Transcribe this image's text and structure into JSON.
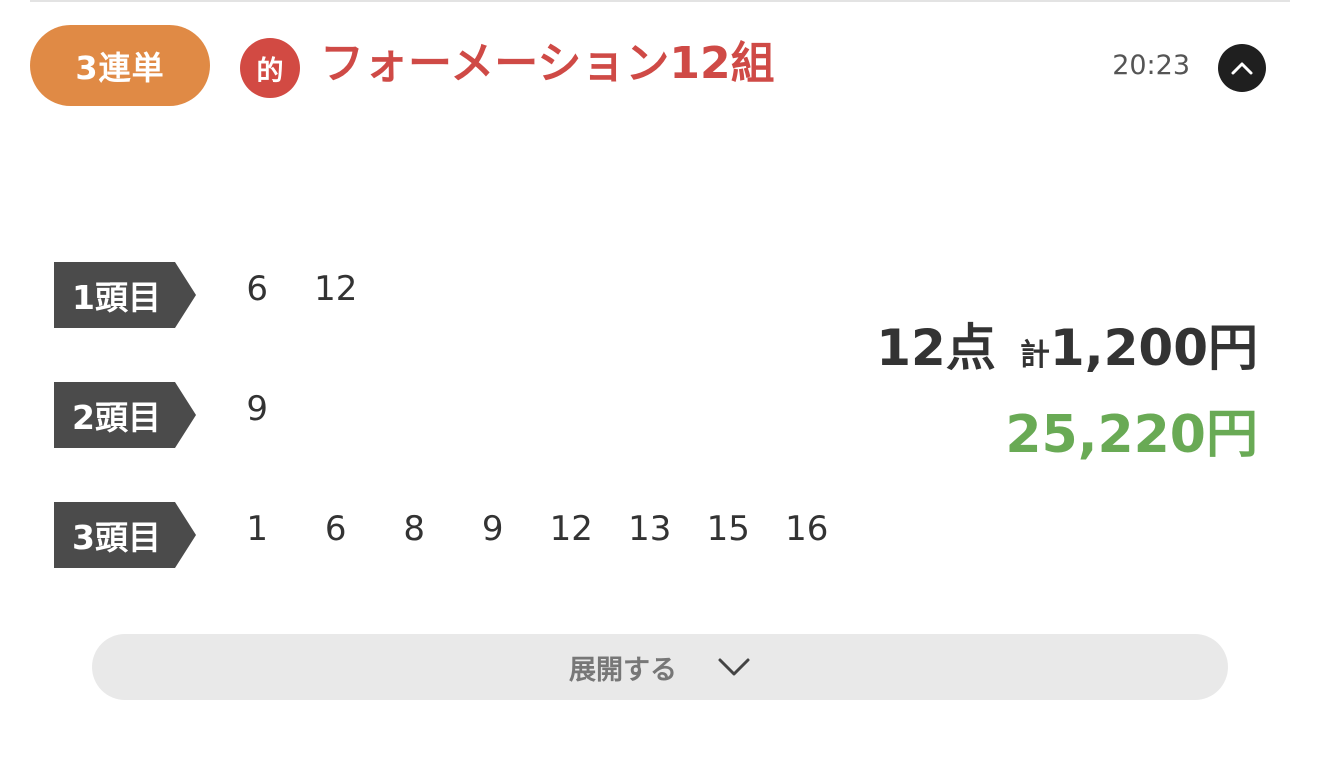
{
  "header": {
    "bet_type": "3連単",
    "hit_badge": "的",
    "title": "フォーメーション12組",
    "time": "20:23"
  },
  "rows": [
    {
      "label": "1頭目",
      "numbers": [
        "6",
        "12"
      ]
    },
    {
      "label": "2頭目",
      "numbers": [
        "9"
      ]
    },
    {
      "label": "3頭目",
      "numbers": [
        "1",
        "6",
        "8",
        "9",
        "12",
        "13",
        "15",
        "16"
      ]
    }
  ],
  "summary": {
    "points": "12点",
    "total_prefix": "計",
    "total_amount": "1,200円",
    "payout": "25,220円"
  },
  "expand": {
    "label": "展開する"
  },
  "colors": {
    "bet_type_pill": "#e08a45",
    "hit_badge": "#d24a43",
    "title": "#cf4a46",
    "payout": "#69aa55",
    "rank_tag": "#4b4b4b"
  },
  "icons": {
    "collapse": "chevron-up-icon",
    "expand": "chevron-down-icon"
  }
}
